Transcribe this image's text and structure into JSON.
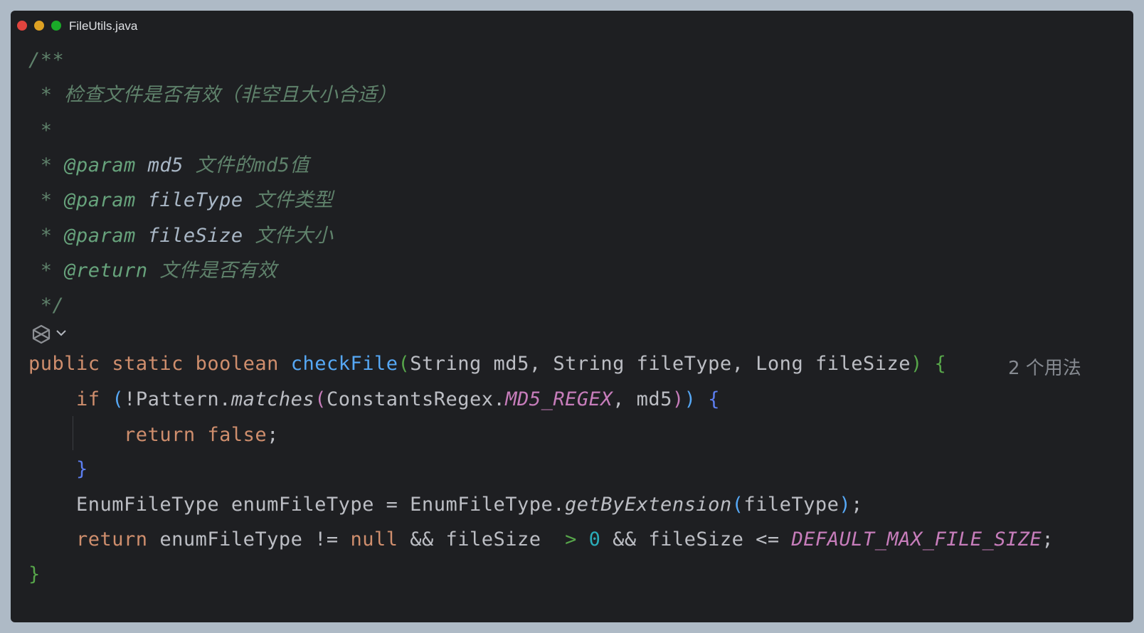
{
  "window": {
    "title": "FileUtils.java"
  },
  "editor": {
    "doc": {
      "open": "/**",
      "summary_star": " * ",
      "summary": "检查文件是否有效（非空且大小合适）",
      "blank": " *",
      "params": [
        {
          "star": " * ",
          "tag": "@param",
          "name": "md5",
          "desc": "文件的md5值"
        },
        {
          "star": " * ",
          "tag": "@param",
          "name": "fileType",
          "desc": "文件类型"
        },
        {
          "star": " * ",
          "tag": "@param",
          "name": "fileSize",
          "desc": "文件大小"
        }
      ],
      "return_star": " * ",
      "return_tag": "@return",
      "return_desc": "文件是否有效",
      "close": " */"
    },
    "usage_hint": "2 个用法",
    "code": {
      "sig_kw1": "public",
      "sig_kw2": "static",
      "sig_kw3": "boolean",
      "sig_fn": "checkFile",
      "sig_open": "(",
      "sig_params": "String md5, String fileType, Long fileSize",
      "sig_close": ")",
      "sig_brace": "{",
      "if_kw": "if",
      "if_open": "(",
      "if_not": "!Pattern.",
      "if_method": "matches",
      "if_popen": "(",
      "if_cls": "ConstantsRegex.",
      "if_const": "MD5_REGEX",
      "if_arg": ", md5",
      "if_pclose": ")",
      "if_close": ")",
      "if_brace": "{",
      "ret_kw": "return",
      "ret_false": "false",
      "semi": ";",
      "if_end": "}",
      "enum_decl": "EnumFileType enumFileType = EnumFileType.",
      "enum_method": "getByExtension",
      "enum_open": "(",
      "enum_arg": "fileType",
      "enum_close": ")",
      "ret2_kw": "return",
      "ret2_a": "enumFileType != ",
      "ret2_null": "null",
      "ret2_b": " && fileSize ",
      "ret2_gt": ">",
      "ret2_zero": "0",
      "ret2_c": " && fileSize <= ",
      "ret2_const": "DEFAULT_MAX_FILE_SIZE",
      "end_brace": "}"
    }
  },
  "colors": {
    "background": "#1e1f22",
    "keyword": "#cf8e6d",
    "function": "#56a8f5",
    "doc_comment": "#5f826b",
    "constant": "#c77dbb",
    "number": "#2aacb8"
  },
  "icons": {
    "gutter": "ai-assistant-icon",
    "fold": "chevron-down-icon"
  }
}
